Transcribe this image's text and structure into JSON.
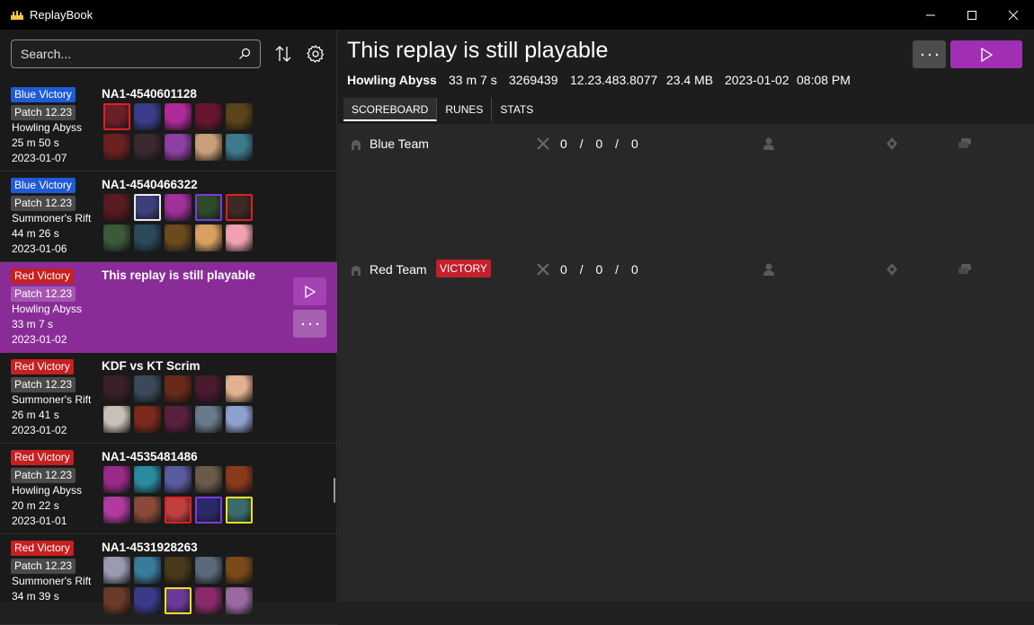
{
  "window": {
    "title": "ReplayBook"
  },
  "search": {
    "placeholder": "Search..."
  },
  "replays": [
    {
      "result": "Blue Victory",
      "result_color": "blue",
      "patch": "Patch 12.23",
      "map": "Howling Abyss",
      "duration": "25 m 50 s",
      "date": "2023-01-07",
      "name": "NA1-4540601128",
      "blue_champs": [
        "#6b1f2a",
        "#3a3e8a",
        "#b02a9a",
        "#6a1530",
        "#5a4418"
      ],
      "red_champs": [
        "#6a2020",
        "#3a2a30",
        "#8e3fa4",
        "#c9a07a",
        "#3d7a8c"
      ],
      "highlights": {
        "0": "hl-red"
      }
    },
    {
      "result": "Blue Victory",
      "result_color": "blue",
      "patch": "Patch 12.23",
      "map": "Summoner's Rift",
      "duration": "44 m 26 s",
      "date": "2023-01-06",
      "name": "NA1-4540466322",
      "blue_champs": [
        "#5a1a22",
        "#3c3f7a",
        "#a0309a",
        "#2e4a2a",
        "#3c2a24"
      ],
      "red_champs": [
        "#3a5a3a",
        "#2a4a5a",
        "#6b4a1e",
        "#d8a060",
        "#f0a0b0"
      ],
      "highlights": {
        "1": "hl-white",
        "3": "hl-purple",
        "4": "hl-red"
      }
    },
    {
      "result": "Red Victory",
      "result_color": "red",
      "patch": "Patch 12.23",
      "map": "Howling Abyss",
      "duration": "33 m 7 s",
      "date": "2023-01-02",
      "name": "This replay is still playable",
      "selected": true,
      "blue_champs": [],
      "red_champs": [],
      "highlights": {}
    },
    {
      "result": "Red Victory",
      "result_color": "red",
      "patch": "Patch 12.23",
      "map": "Summoner's Rift",
      "duration": "26 m 41 s",
      "date": "2023-01-02",
      "name": "KDF vs KT Scrim",
      "blue_champs": [
        "#3a2028",
        "#3a4a5a",
        "#6a2a1a",
        "#4a1a30",
        "#e0b090"
      ],
      "red_champs": [
        "#c8c0b8",
        "#7a2a1a",
        "#5a2040",
        "#6a7a8a",
        "#8ea0d0"
      ],
      "highlights": {}
    },
    {
      "result": "Red Victory",
      "result_color": "red",
      "patch": "Patch 12.23",
      "map": "Howling Abyss",
      "duration": "20 m 22 s",
      "date": "2023-01-01",
      "name": "NA1-4535481486",
      "blue_champs": [
        "#9a2a8a",
        "#2a8aa0",
        "#5a5aa0",
        "#6a5a4a",
        "#8a3a1a"
      ],
      "red_champs": [
        "#b03aa0",
        "#8a4a3a",
        "#c04040",
        "#2a2a6a",
        "#3a6a6a"
      ],
      "highlights": {
        "7": "hl-red",
        "8": "hl-purple",
        "9": "hl-yellow"
      }
    },
    {
      "result": "Red Victory",
      "result_color": "red",
      "patch": "Patch 12.23",
      "map": "Summoner's Rift",
      "duration": "34 m 39 s",
      "date": "",
      "name": "NA1-4531928263",
      "blue_champs": [
        "#9a9ab0",
        "#3a7a9a",
        "#4a3a1a",
        "#5a6a7a",
        "#7a4a1a"
      ],
      "red_champs": [
        "#6a3a2a",
        "#3a3a8a",
        "#6a3a9a",
        "#8a2a6a",
        "#9a6aa0"
      ],
      "highlights": {
        "7": "hl-yellow"
      }
    }
  ],
  "selected_replay": {
    "title": "This replay is still playable",
    "map": "Howling Abyss",
    "duration": "33 m 7 s",
    "game_id": "3269439",
    "version": "12.23.483.8077",
    "size": "23.4 MB",
    "date": "2023-01-02",
    "time": "08:08 PM"
  },
  "tabs": [
    "SCOREBOARD",
    "RUNES",
    "STATS"
  ],
  "teams": [
    {
      "name": "Blue Team",
      "victory": "",
      "kills": "0",
      "deaths": "0",
      "assists": "0"
    },
    {
      "name": "Red Team",
      "victory": "VICTORY",
      "kills": "0",
      "deaths": "0",
      "assists": "0"
    }
  ],
  "kda_separator": "/",
  "icons": [
    "search-icon",
    "sort-icon",
    "settings-icon",
    "play-icon",
    "more-icon",
    "minimize-icon",
    "maximize-icon",
    "close-icon",
    "helmet-icon",
    "crossed-swords-icon",
    "person-icon",
    "gold-icon",
    "stack-icon"
  ]
}
